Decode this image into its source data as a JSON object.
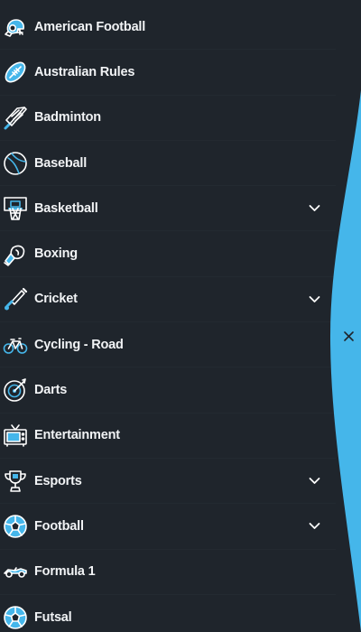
{
  "colors": {
    "background": "#1f252c",
    "text": "#f1f3f5",
    "icon_accent": "#45b6ea",
    "icon_outline": "#ffffff",
    "overlay": "#45b6ea",
    "close_icon": "#1f252c"
  },
  "sports_menu": {
    "items": [
      {
        "label": "American Football",
        "icon": "american-football-helmet-icon",
        "expandable": false
      },
      {
        "label": "Australian Rules",
        "icon": "australian-rules-ball-icon",
        "expandable": false
      },
      {
        "label": "Badminton",
        "icon": "shuttlecock-icon",
        "expandable": false
      },
      {
        "label": "Baseball",
        "icon": "baseball-icon",
        "expandable": false
      },
      {
        "label": "Basketball",
        "icon": "basketball-hoop-icon",
        "expandable": true
      },
      {
        "label": "Boxing",
        "icon": "boxing-gloves-icon",
        "expandable": false
      },
      {
        "label": "Cricket",
        "icon": "cricket-bat-icon",
        "expandable": true
      },
      {
        "label": "Cycling - Road",
        "icon": "bicycle-icon",
        "expandable": false
      },
      {
        "label": "Darts",
        "icon": "dartboard-icon",
        "expandable": false
      },
      {
        "label": "Entertainment",
        "icon": "tv-icon",
        "expandable": false
      },
      {
        "label": "Esports",
        "icon": "trophy-icon",
        "expandable": true
      },
      {
        "label": "Football",
        "icon": "soccer-ball-icon",
        "expandable": true
      },
      {
        "label": "Formula 1",
        "icon": "race-car-icon",
        "expandable": false
      },
      {
        "label": "Futsal",
        "icon": "futsal-ball-icon",
        "expandable": false
      }
    ]
  },
  "overlay": {
    "close_icon": "close-icon"
  }
}
